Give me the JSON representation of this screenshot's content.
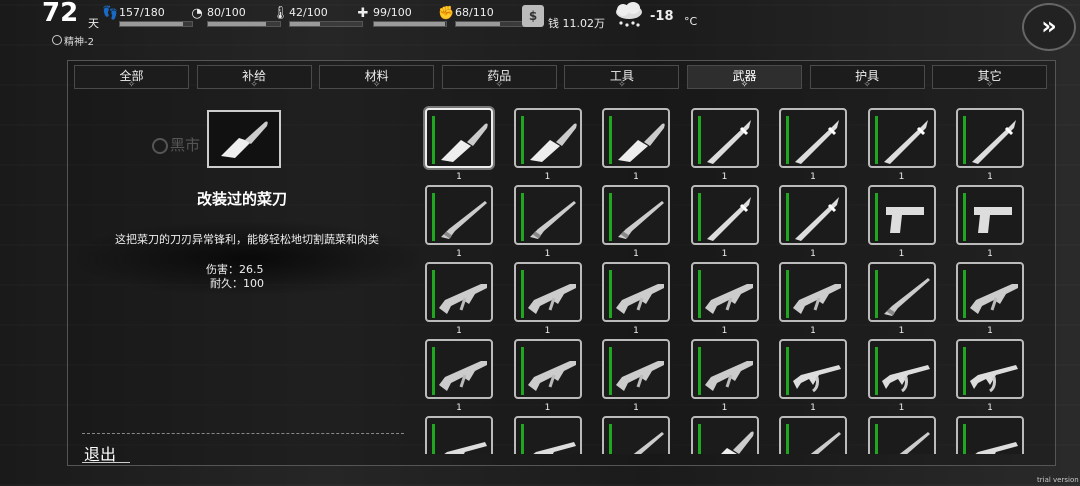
{
  "hud": {
    "day_number": "72",
    "day_unit": "天",
    "stats": [
      {
        "icon": "footprints-icon",
        "glyph": "👣",
        "value": "157/180",
        "fraction": 0.872
      },
      {
        "icon": "stomach-icon",
        "glyph": "◔",
        "value": "80/100",
        "fraction": 0.8
      },
      {
        "icon": "thermometer-icon",
        "glyph": "🌡",
        "value": "42/100",
        "fraction": 0.42
      },
      {
        "icon": "health-cross-icon",
        "glyph": "✚",
        "value": "99/100",
        "fraction": 0.99
      },
      {
        "icon": "fist-icon",
        "glyph": "✊",
        "value": "68/110",
        "fraction": 0.618
      }
    ],
    "money_icon_glyph": "$",
    "money": "钱 11.02万",
    "temperature": "-18",
    "temperature_unit": "°C",
    "spirit": "精神-2",
    "next_glyph": "»"
  },
  "tabs": [
    {
      "label": "全部",
      "active": false
    },
    {
      "label": "补给",
      "active": false
    },
    {
      "label": "材料",
      "active": false
    },
    {
      "label": "药品",
      "active": false
    },
    {
      "label": "工具",
      "active": false
    },
    {
      "label": "武器",
      "active": true
    },
    {
      "label": "护具",
      "active": false
    },
    {
      "label": "其它",
      "active": false
    }
  ],
  "tab_star_glyph": "✧",
  "background_sign": "黑市",
  "detail": {
    "name": "改装过的菜刀",
    "description": "这把菜刀的刀刃异常锋利，能够轻松地切割蔬菜和肉类",
    "damage": "伤害：26.5",
    "durability": "耐久：100"
  },
  "exit_label": "退出",
  "trial_label": "trial version",
  "items": [
    {
      "kind": "cleaver",
      "count": "1",
      "selected": true
    },
    {
      "kind": "cleaver",
      "count": "1"
    },
    {
      "kind": "cleaver",
      "count": "1"
    },
    {
      "kind": "sword",
      "count": "1"
    },
    {
      "kind": "sword",
      "count": "1"
    },
    {
      "kind": "sword",
      "count": "1"
    },
    {
      "kind": "sword",
      "count": "1"
    },
    {
      "kind": "shotgun",
      "count": "1"
    },
    {
      "kind": "shotgun",
      "count": "1"
    },
    {
      "kind": "shotgun",
      "count": "1"
    },
    {
      "kind": "sword",
      "count": "1"
    },
    {
      "kind": "sword",
      "count": "1"
    },
    {
      "kind": "pistol",
      "count": "1"
    },
    {
      "kind": "pistol",
      "count": "1"
    },
    {
      "kind": "rifle",
      "count": "1"
    },
    {
      "kind": "rifle",
      "count": "1"
    },
    {
      "kind": "rifle",
      "count": "1"
    },
    {
      "kind": "rifle",
      "count": "1"
    },
    {
      "kind": "rifle",
      "count": "1"
    },
    {
      "kind": "shotgun",
      "count": "1"
    },
    {
      "kind": "rifle",
      "count": "1"
    },
    {
      "kind": "rifle",
      "count": "1"
    },
    {
      "kind": "rifle",
      "count": "1"
    },
    {
      "kind": "rifle",
      "count": "1"
    },
    {
      "kind": "rifle",
      "count": "1"
    },
    {
      "kind": "ak",
      "count": "1"
    },
    {
      "kind": "ak",
      "count": "1"
    },
    {
      "kind": "ak",
      "count": "1"
    },
    {
      "kind": "ak",
      "count": ""
    },
    {
      "kind": "ak",
      "count": ""
    },
    {
      "kind": "shotgun",
      "count": ""
    },
    {
      "kind": "cleaver",
      "count": ""
    },
    {
      "kind": "shotgun",
      "count": ""
    },
    {
      "kind": "shotgun",
      "count": ""
    },
    {
      "kind": "ak",
      "count": ""
    }
  ],
  "colors": {
    "durability_bar": "#1fa81f",
    "frame": "#bbbbbb"
  }
}
